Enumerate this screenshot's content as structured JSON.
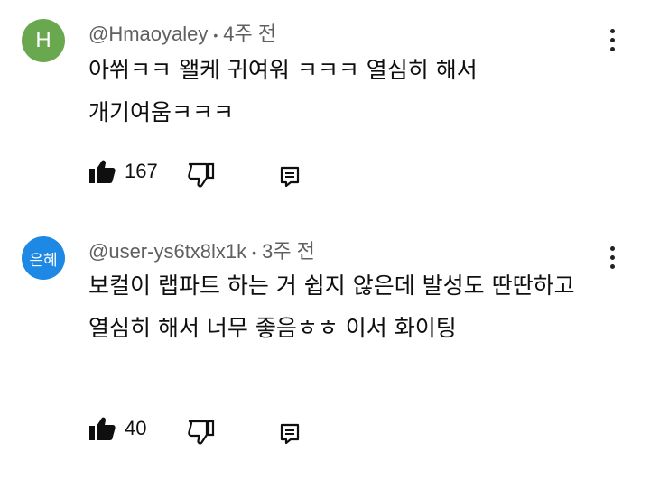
{
  "colors": {
    "avatar_1": "#6aa84f",
    "avatar_2": "#1e88e5"
  },
  "comments": [
    {
      "avatar_text": "H",
      "author": "@Hmaoyaley",
      "separator": "•",
      "time": "4주 전",
      "text": "아쒸ㅋㅋ 왤케 귀여워 ㅋㅋㅋ 열심히 해서 개기여움ㅋㅋㅋ",
      "likes": "167"
    },
    {
      "avatar_text": "은혜",
      "author": "@user-ys6tx8lx1k",
      "separator": "•",
      "time": "3주 전",
      "text": "보컬이 랩파트 하는 거 쉽지 않은데 발성도 딴딴하고 열심히 해서 너무 좋음ㅎㅎ 이서 화이팅",
      "likes": "40"
    }
  ]
}
